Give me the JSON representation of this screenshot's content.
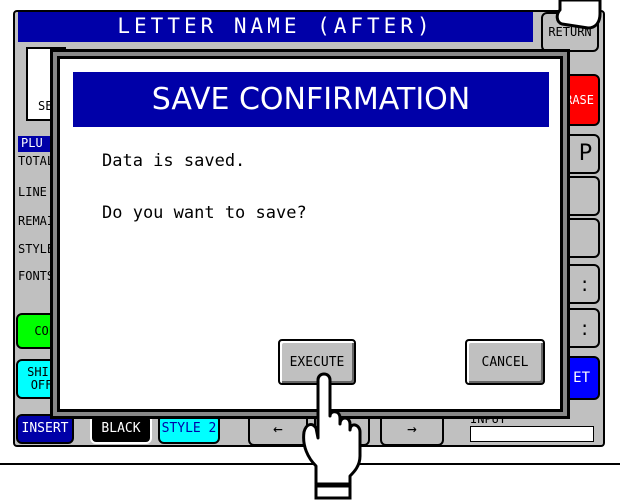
{
  "screen": {
    "title": "LETTER NAME (AFTER)",
    "return_label": "RETURN",
    "erase_label": "RASE",
    "se_label": "SE",
    "plu_tab": "PLU",
    "left_labels": [
      "TOTAL",
      "LINE",
      "REMAI",
      "STYLE",
      "FONTS"
    ],
    "right_keys": [
      "P",
      "",
      "",
      ":",
      ":"
    ],
    "copy_label": "COP",
    "shift_label": "SHIF\nOFF",
    "set_label": "ET",
    "insert_label": "INSERT",
    "black_label": "BLACK",
    "style_label": "STYLE 2",
    "left_arrow": "←",
    "right_arrow": "→",
    "input_label": "INPUT",
    "colors": {
      "title_blue": "#0000a8",
      "erase_red": "#ff0000",
      "set_blue": "#0000ff",
      "copy_green": "#00ff00",
      "shift_cyan": "#00ffff"
    }
  },
  "dialog": {
    "title": "SAVE CONFIRMATION",
    "line1": "Data is saved.",
    "line2": "Do you want to save?",
    "execute_label": "EXECUTE",
    "cancel_label": "CANCEL"
  }
}
